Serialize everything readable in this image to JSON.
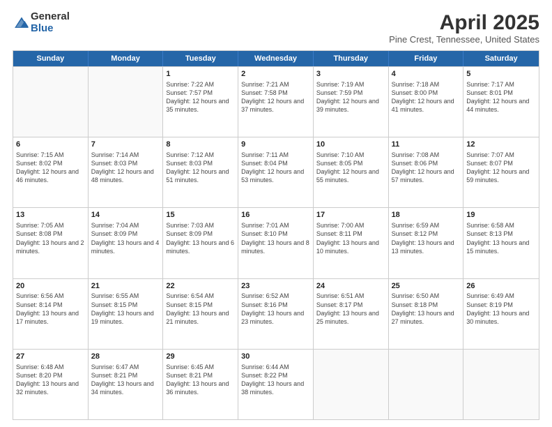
{
  "logo": {
    "general": "General",
    "blue": "Blue"
  },
  "header": {
    "title": "April 2025",
    "subtitle": "Pine Crest, Tennessee, United States"
  },
  "weekdays": [
    "Sunday",
    "Monday",
    "Tuesday",
    "Wednesday",
    "Thursday",
    "Friday",
    "Saturday"
  ],
  "weeks": [
    [
      {
        "day": "",
        "info": ""
      },
      {
        "day": "",
        "info": ""
      },
      {
        "day": "1",
        "info": "Sunrise: 7:22 AM\nSunset: 7:57 PM\nDaylight: 12 hours and 35 minutes."
      },
      {
        "day": "2",
        "info": "Sunrise: 7:21 AM\nSunset: 7:58 PM\nDaylight: 12 hours and 37 minutes."
      },
      {
        "day": "3",
        "info": "Sunrise: 7:19 AM\nSunset: 7:59 PM\nDaylight: 12 hours and 39 minutes."
      },
      {
        "day": "4",
        "info": "Sunrise: 7:18 AM\nSunset: 8:00 PM\nDaylight: 12 hours and 41 minutes."
      },
      {
        "day": "5",
        "info": "Sunrise: 7:17 AM\nSunset: 8:01 PM\nDaylight: 12 hours and 44 minutes."
      }
    ],
    [
      {
        "day": "6",
        "info": "Sunrise: 7:15 AM\nSunset: 8:02 PM\nDaylight: 12 hours and 46 minutes."
      },
      {
        "day": "7",
        "info": "Sunrise: 7:14 AM\nSunset: 8:03 PM\nDaylight: 12 hours and 48 minutes."
      },
      {
        "day": "8",
        "info": "Sunrise: 7:12 AM\nSunset: 8:03 PM\nDaylight: 12 hours and 51 minutes."
      },
      {
        "day": "9",
        "info": "Sunrise: 7:11 AM\nSunset: 8:04 PM\nDaylight: 12 hours and 53 minutes."
      },
      {
        "day": "10",
        "info": "Sunrise: 7:10 AM\nSunset: 8:05 PM\nDaylight: 12 hours and 55 minutes."
      },
      {
        "day": "11",
        "info": "Sunrise: 7:08 AM\nSunset: 8:06 PM\nDaylight: 12 hours and 57 minutes."
      },
      {
        "day": "12",
        "info": "Sunrise: 7:07 AM\nSunset: 8:07 PM\nDaylight: 12 hours and 59 minutes."
      }
    ],
    [
      {
        "day": "13",
        "info": "Sunrise: 7:05 AM\nSunset: 8:08 PM\nDaylight: 13 hours and 2 minutes."
      },
      {
        "day": "14",
        "info": "Sunrise: 7:04 AM\nSunset: 8:09 PM\nDaylight: 13 hours and 4 minutes."
      },
      {
        "day": "15",
        "info": "Sunrise: 7:03 AM\nSunset: 8:09 PM\nDaylight: 13 hours and 6 minutes."
      },
      {
        "day": "16",
        "info": "Sunrise: 7:01 AM\nSunset: 8:10 PM\nDaylight: 13 hours and 8 minutes."
      },
      {
        "day": "17",
        "info": "Sunrise: 7:00 AM\nSunset: 8:11 PM\nDaylight: 13 hours and 10 minutes."
      },
      {
        "day": "18",
        "info": "Sunrise: 6:59 AM\nSunset: 8:12 PM\nDaylight: 13 hours and 13 minutes."
      },
      {
        "day": "19",
        "info": "Sunrise: 6:58 AM\nSunset: 8:13 PM\nDaylight: 13 hours and 15 minutes."
      }
    ],
    [
      {
        "day": "20",
        "info": "Sunrise: 6:56 AM\nSunset: 8:14 PM\nDaylight: 13 hours and 17 minutes."
      },
      {
        "day": "21",
        "info": "Sunrise: 6:55 AM\nSunset: 8:15 PM\nDaylight: 13 hours and 19 minutes."
      },
      {
        "day": "22",
        "info": "Sunrise: 6:54 AM\nSunset: 8:15 PM\nDaylight: 13 hours and 21 minutes."
      },
      {
        "day": "23",
        "info": "Sunrise: 6:52 AM\nSunset: 8:16 PM\nDaylight: 13 hours and 23 minutes."
      },
      {
        "day": "24",
        "info": "Sunrise: 6:51 AM\nSunset: 8:17 PM\nDaylight: 13 hours and 25 minutes."
      },
      {
        "day": "25",
        "info": "Sunrise: 6:50 AM\nSunset: 8:18 PM\nDaylight: 13 hours and 27 minutes."
      },
      {
        "day": "26",
        "info": "Sunrise: 6:49 AM\nSunset: 8:19 PM\nDaylight: 13 hours and 30 minutes."
      }
    ],
    [
      {
        "day": "27",
        "info": "Sunrise: 6:48 AM\nSunset: 8:20 PM\nDaylight: 13 hours and 32 minutes."
      },
      {
        "day": "28",
        "info": "Sunrise: 6:47 AM\nSunset: 8:21 PM\nDaylight: 13 hours and 34 minutes."
      },
      {
        "day": "29",
        "info": "Sunrise: 6:45 AM\nSunset: 8:21 PM\nDaylight: 13 hours and 36 minutes."
      },
      {
        "day": "30",
        "info": "Sunrise: 6:44 AM\nSunset: 8:22 PM\nDaylight: 13 hours and 38 minutes."
      },
      {
        "day": "",
        "info": ""
      },
      {
        "day": "",
        "info": ""
      },
      {
        "day": "",
        "info": ""
      }
    ]
  ]
}
